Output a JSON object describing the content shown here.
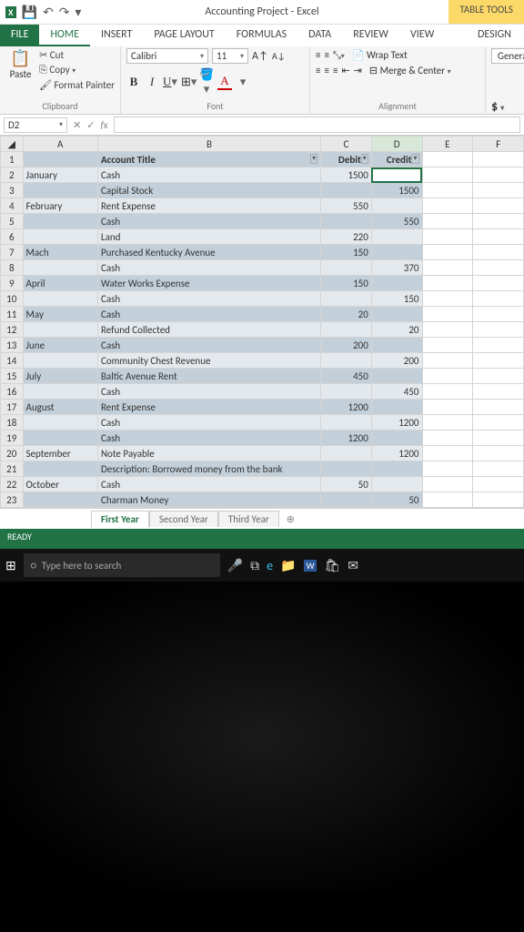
{
  "titlebar": {
    "title": "Accounting Project - Excel",
    "tools_tab": "TABLE TOOLS"
  },
  "menu": {
    "file": "FILE",
    "home": "HOME",
    "insert": "INSERT",
    "pageLayout": "PAGE LAYOUT",
    "formulas": "FORMULAS",
    "data": "DATA",
    "review": "REVIEW",
    "view": "VIEW",
    "design": "DESIGN"
  },
  "ribbon": {
    "cut": "Cut",
    "copy": "Copy",
    "formatPainter": "Format Painter",
    "paste": "Paste",
    "clipboard": "Clipboard",
    "fontGroup": "Font",
    "fontName": "Calibri",
    "fontSize": "11",
    "wrapText": "Wrap Text",
    "mergeCenter": "Merge & Center",
    "alignment": "Alignment",
    "general": "Genera"
  },
  "namebox": {
    "ref": "D2"
  },
  "columns": {
    "A": "A",
    "B": "B",
    "C": "C",
    "D": "D",
    "E": "E",
    "F": "F"
  },
  "headers": {
    "accountTitle": "Account Title",
    "debit": "Debit",
    "credit": "Credit"
  },
  "rows": [
    {
      "n": "2",
      "A": "January",
      "B": "Cash",
      "C": "1500",
      "D": ""
    },
    {
      "n": "3",
      "A": "",
      "B": "   Capital Stock",
      "C": "",
      "D": "1500"
    },
    {
      "n": "4",
      "A": "February",
      "B": "Rent Expense",
      "C": "550",
      "D": ""
    },
    {
      "n": "5",
      "A": "",
      "B": "   Cash",
      "C": "",
      "D": "550"
    },
    {
      "n": "6",
      "A": "",
      "B": "Land",
      "C": "220",
      "D": ""
    },
    {
      "n": "7",
      "A": "Mach",
      "B": "Purchased Kentucky Avenue",
      "C": "150",
      "D": ""
    },
    {
      "n": "8",
      "A": "",
      "B": "   Cash",
      "C": "",
      "D": "370"
    },
    {
      "n": "9",
      "A": "April",
      "B": "Water Works Expense",
      "C": "150",
      "D": ""
    },
    {
      "n": "10",
      "A": "",
      "B": "   Cash",
      "C": "",
      "D": "150"
    },
    {
      "n": "11",
      "A": "May",
      "B": "Cash",
      "C": "20",
      "D": ""
    },
    {
      "n": "12",
      "A": "",
      "B": "   Refund Collected",
      "C": "",
      "D": "20"
    },
    {
      "n": "13",
      "A": "June",
      "B": "Cash",
      "C": "200",
      "D": ""
    },
    {
      "n": "14",
      "A": "",
      "B": "   Community Chest Revenue",
      "C": "",
      "D": "200"
    },
    {
      "n": "15",
      "A": "July",
      "B": "Baltic Avenue Rent",
      "C": "450",
      "D": ""
    },
    {
      "n": "16",
      "A": "",
      "B": "   Cash",
      "C": "",
      "D": "450"
    },
    {
      "n": "17",
      "A": "August",
      "B": "Rent Expense",
      "C": "1200",
      "D": ""
    },
    {
      "n": "18",
      "A": "",
      "B": "   Cash",
      "C": "",
      "D": "1200"
    },
    {
      "n": "19",
      "A": "",
      "B": "Cash",
      "C": "1200",
      "D": ""
    },
    {
      "n": "20",
      "A": "September",
      "B": "   Note Payable",
      "C": "",
      "D": "1200"
    },
    {
      "n": "21",
      "A": "",
      "B": "   Description: Borrowed money from the bank",
      "C": "",
      "D": ""
    },
    {
      "n": "22",
      "A": "October",
      "B": "Cash",
      "C": "50",
      "D": ""
    },
    {
      "n": "23",
      "A": "",
      "B": "   Charman Money",
      "C": "",
      "D": "50"
    }
  ],
  "sheets": {
    "s1": "First Year",
    "s2": "Second Year",
    "s3": "Third Year"
  },
  "status": {
    "ready": "READY"
  },
  "taskbar": {
    "searchPlaceholder": "Type here to search"
  }
}
